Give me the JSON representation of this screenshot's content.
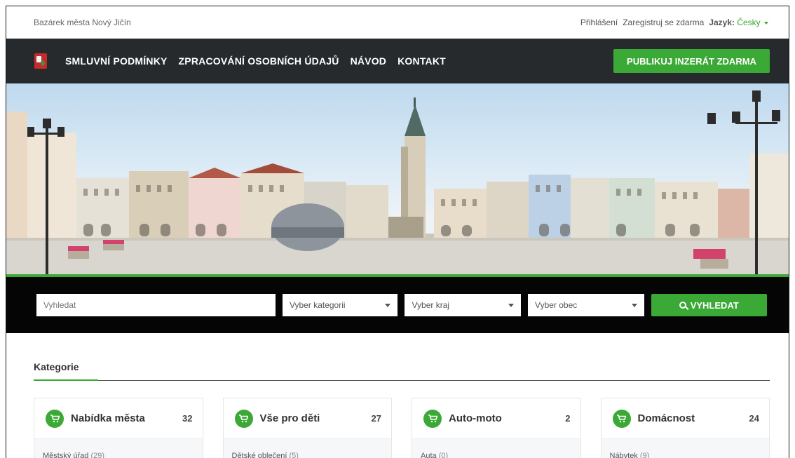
{
  "topbar": {
    "site_title": "Bazárek města Nový Jičín",
    "login": "Přihlášení",
    "register": "Zaregistruj se zdarma",
    "language_label": "Jazyk:",
    "language_value": "Česky"
  },
  "navbar": {
    "links": [
      {
        "label": "SMLUVNÍ PODMÍNKY"
      },
      {
        "label": "ZPRACOVÁNÍ OSOBNÍCH ÚDAJŮ"
      },
      {
        "label": "NÁVOD"
      },
      {
        "label": "KONTAKT"
      }
    ],
    "publish_button": "PUBLIKUJ INZERÁT ZDARMA"
  },
  "search": {
    "placeholder": "Vyhledat",
    "category_select": "Vyber kategorii",
    "region_select": "Vyber kraj",
    "town_select": "Vyber obec",
    "search_button": "VYHLEDAT"
  },
  "categories": {
    "heading": "Kategorie",
    "cards": [
      {
        "title": "Nabídka města",
        "count": "32",
        "sub_label": "Městský úřad",
        "sub_count": "(29)"
      },
      {
        "title": "Vše pro děti",
        "count": "27",
        "sub_label": "Dětské oblečení",
        "sub_count": "(5)"
      },
      {
        "title": "Auto-moto",
        "count": "2",
        "sub_label": "Auta",
        "sub_count": "(0)"
      },
      {
        "title": "Domácnost",
        "count": "24",
        "sub_label": "Nábytek",
        "sub_count": "(9)"
      }
    ]
  },
  "colors": {
    "accent_green": "#3ba935",
    "navbar_bg": "#262a2d",
    "search_bg": "#050505"
  },
  "icons": {
    "logo": "city-coat-of-arms-icon",
    "search": "search-icon",
    "cart": "shopping-cart-icon",
    "caret": "caret-down-icon"
  }
}
